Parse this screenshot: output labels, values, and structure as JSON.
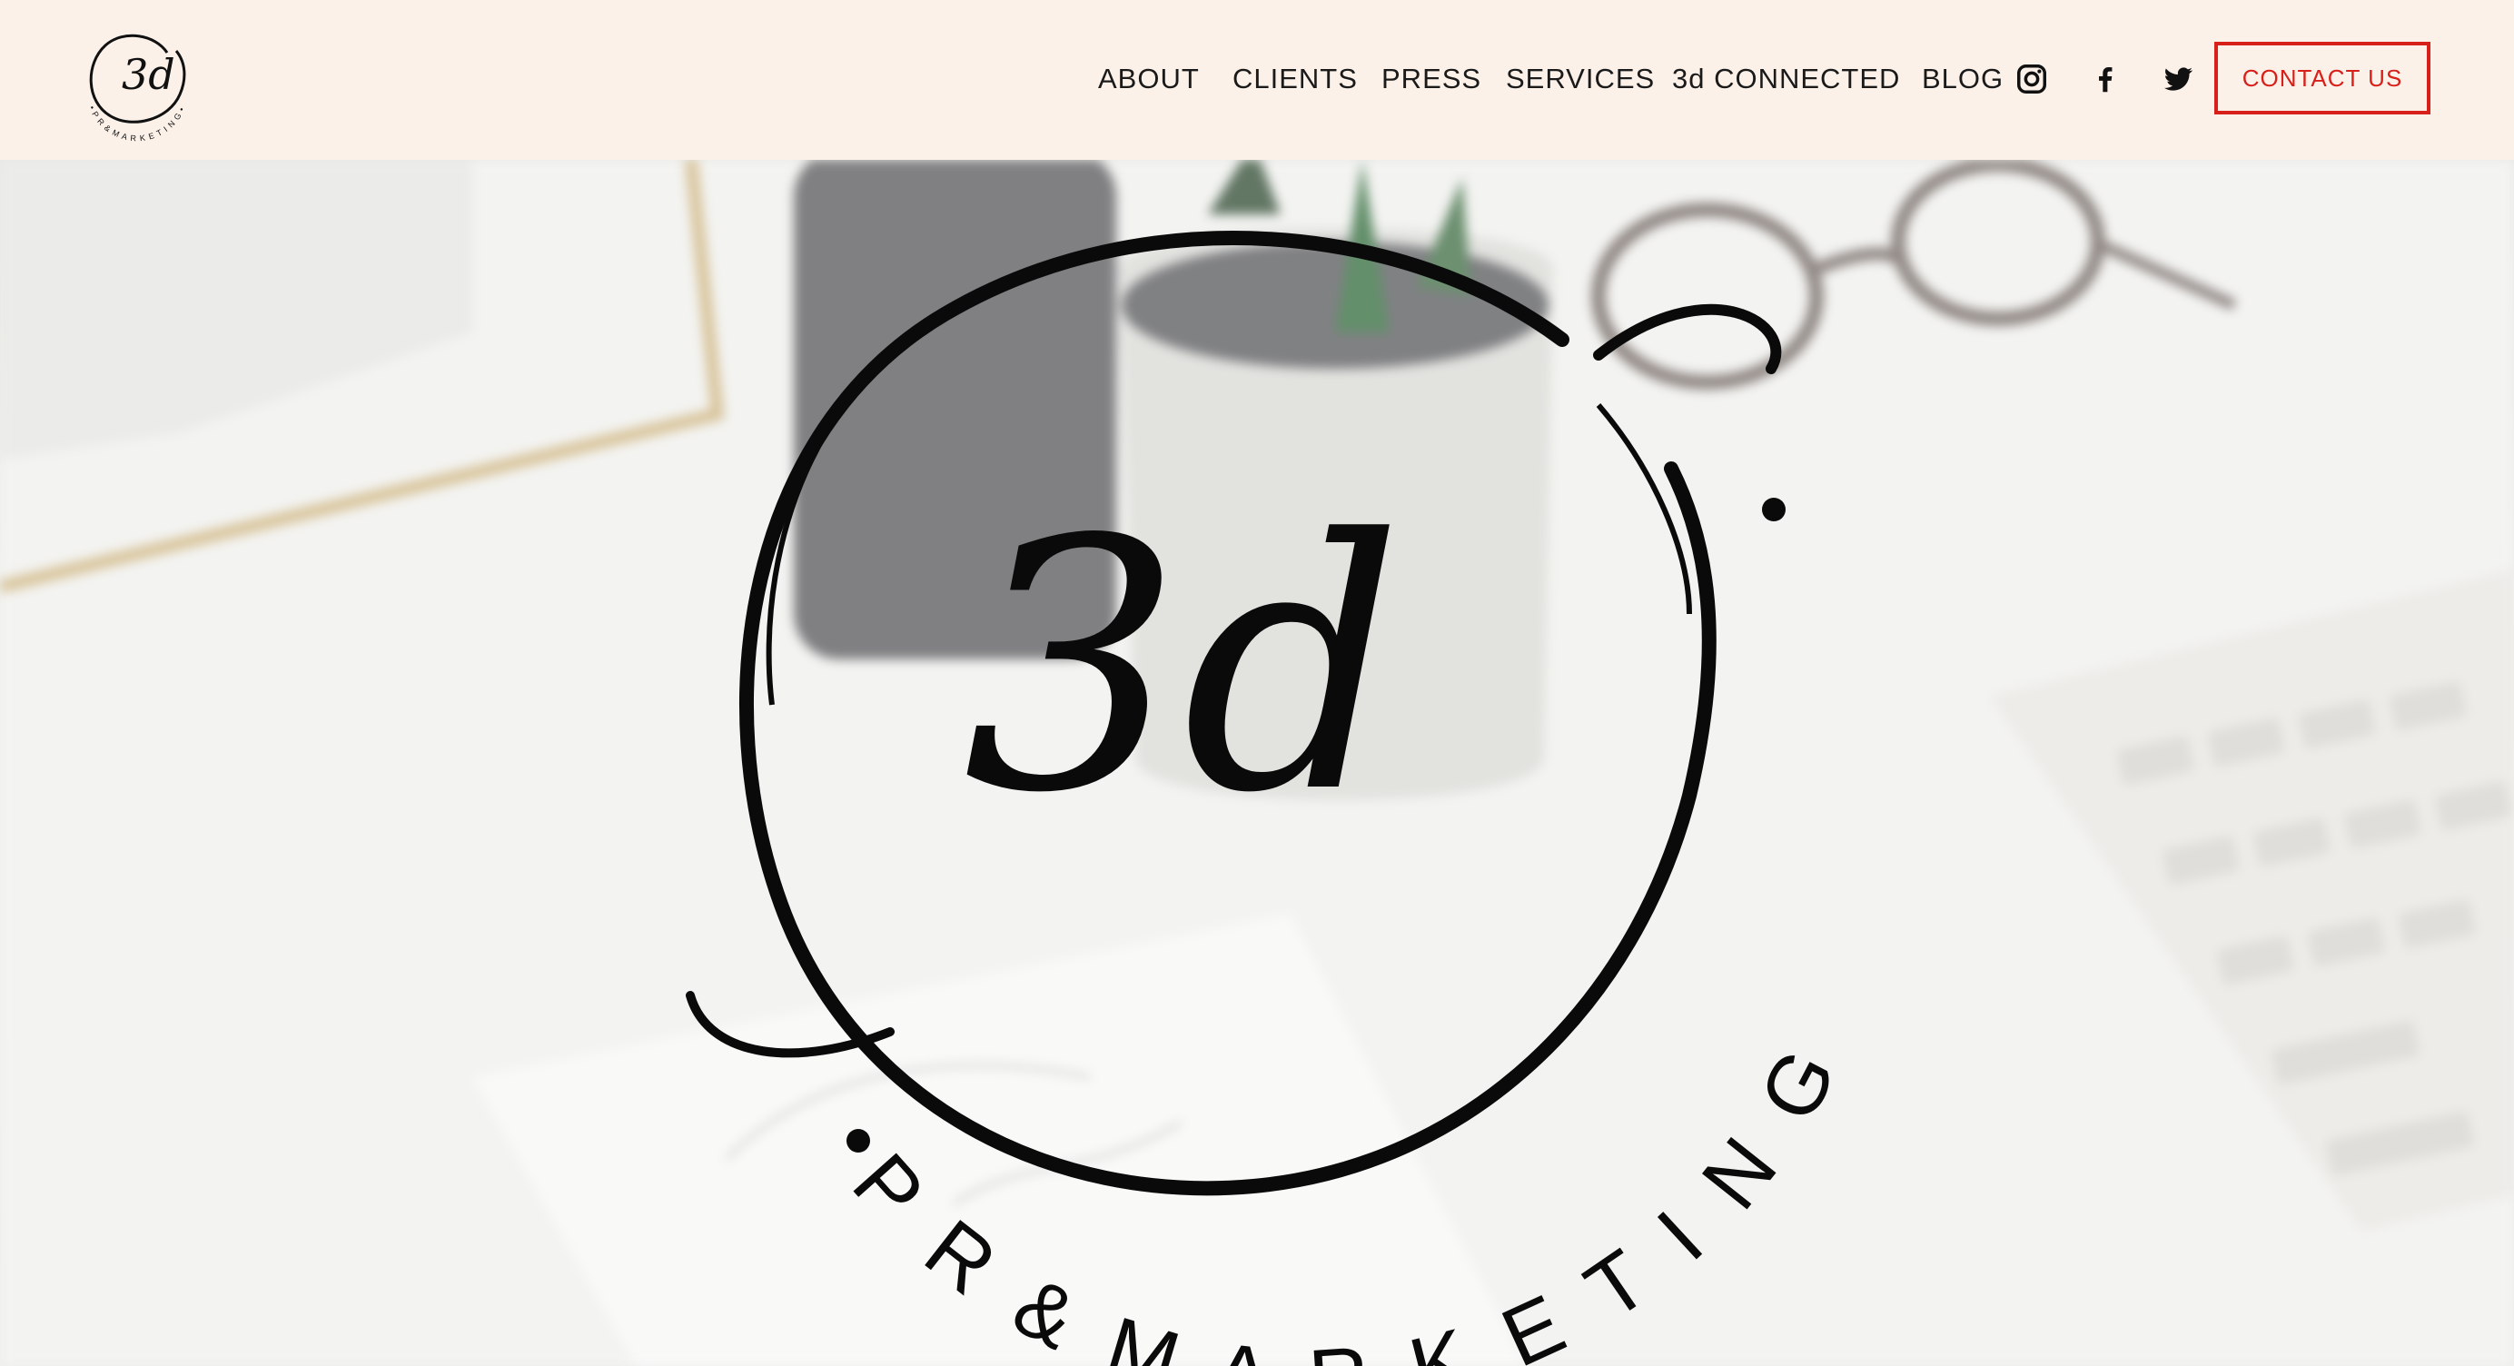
{
  "header": {
    "logo": {
      "text": "3d",
      "ring_text": "• P R & M A R K E T I N G •"
    },
    "nav": [
      {
        "label": "ABOUT"
      },
      {
        "label": "CLIENTS"
      },
      {
        "label": "PRESS"
      },
      {
        "label": "SERVICES"
      },
      {
        "label": "3d CONNECTED"
      },
      {
        "label": "BLOG"
      }
    ],
    "social": [
      {
        "icon": "instagram-icon"
      },
      {
        "icon": "facebook-icon"
      },
      {
        "icon": "twitter-icon"
      }
    ],
    "contact_label": "CONTACT US"
  },
  "hero": {
    "logo": {
      "monogram": "3d",
      "ring_text": "P R & M A R K E T I N G"
    }
  },
  "colors": {
    "header_bg": "#fcf1e9",
    "accent": "#d8201a",
    "text": "#1a1a1a"
  }
}
